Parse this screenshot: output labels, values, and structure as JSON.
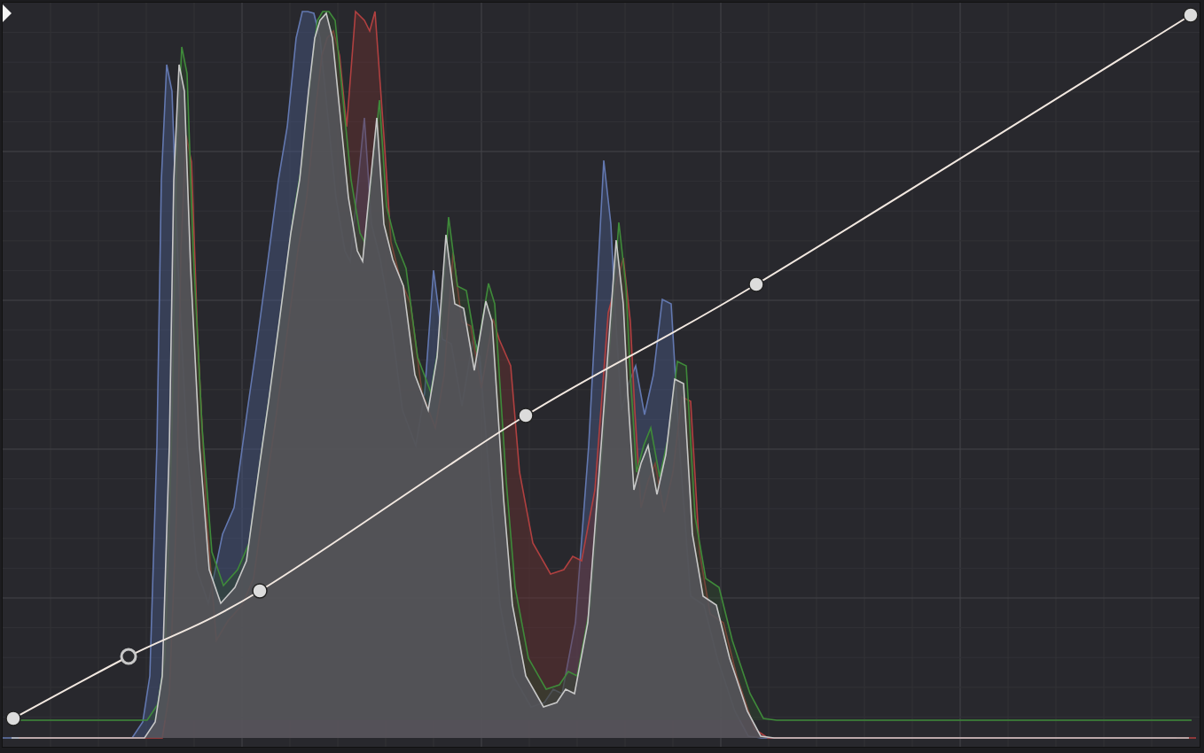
{
  "curve_editor": {
    "control_points": [
      {
        "selected": false
      },
      {
        "selected": true
      },
      {
        "selected": false
      },
      {
        "selected": false
      },
      {
        "selected": false
      },
      {
        "selected": false
      }
    ]
  }
}
